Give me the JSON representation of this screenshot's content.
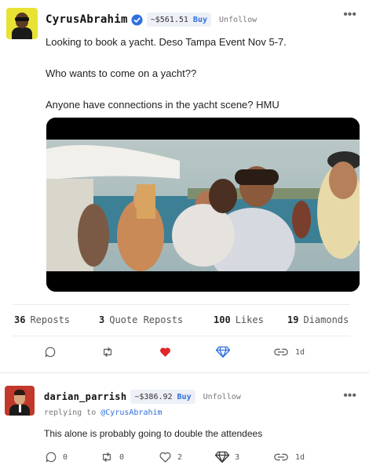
{
  "post": {
    "username": "CyrusAbrahim",
    "coin_price": "~$561.51",
    "buy_label": "Buy",
    "follow_label": "Unfollow",
    "body": [
      "Looking to book a yacht. Deso Tampa Event Nov 5-7.",
      "Who wants to come on a yacht??",
      "Anyone have connections in the yacht scene? HMU"
    ],
    "stats": {
      "reposts_count": "36",
      "reposts_label": "Reposts",
      "quote_count": "3",
      "quote_label": "Quote Reposts",
      "likes_count": "100",
      "likes_label": "Likes",
      "diamonds_count": "19",
      "diamonds_label": "Diamonds"
    },
    "time": "1d",
    "liked": true,
    "colors": {
      "like": "#e0262b",
      "diamond": "#2f6fe0",
      "buy": "#2f6fe0"
    }
  },
  "reply": {
    "username": "darian_parrish",
    "coin_price": "~$386.92",
    "buy_label": "Buy",
    "follow_label": "Unfollow",
    "replying_prefix": "replying to",
    "replying_to": "@CyrusAbrahim",
    "text": "This alone is probably going to double the attendees",
    "comments": "0",
    "reposts": "0",
    "likes": "2",
    "diamonds": "3",
    "time": "1d"
  },
  "icons": [
    "verified-icon",
    "more-icon",
    "comment-icon",
    "repost-icon",
    "heart-icon",
    "diamond-icon",
    "link-icon"
  ]
}
